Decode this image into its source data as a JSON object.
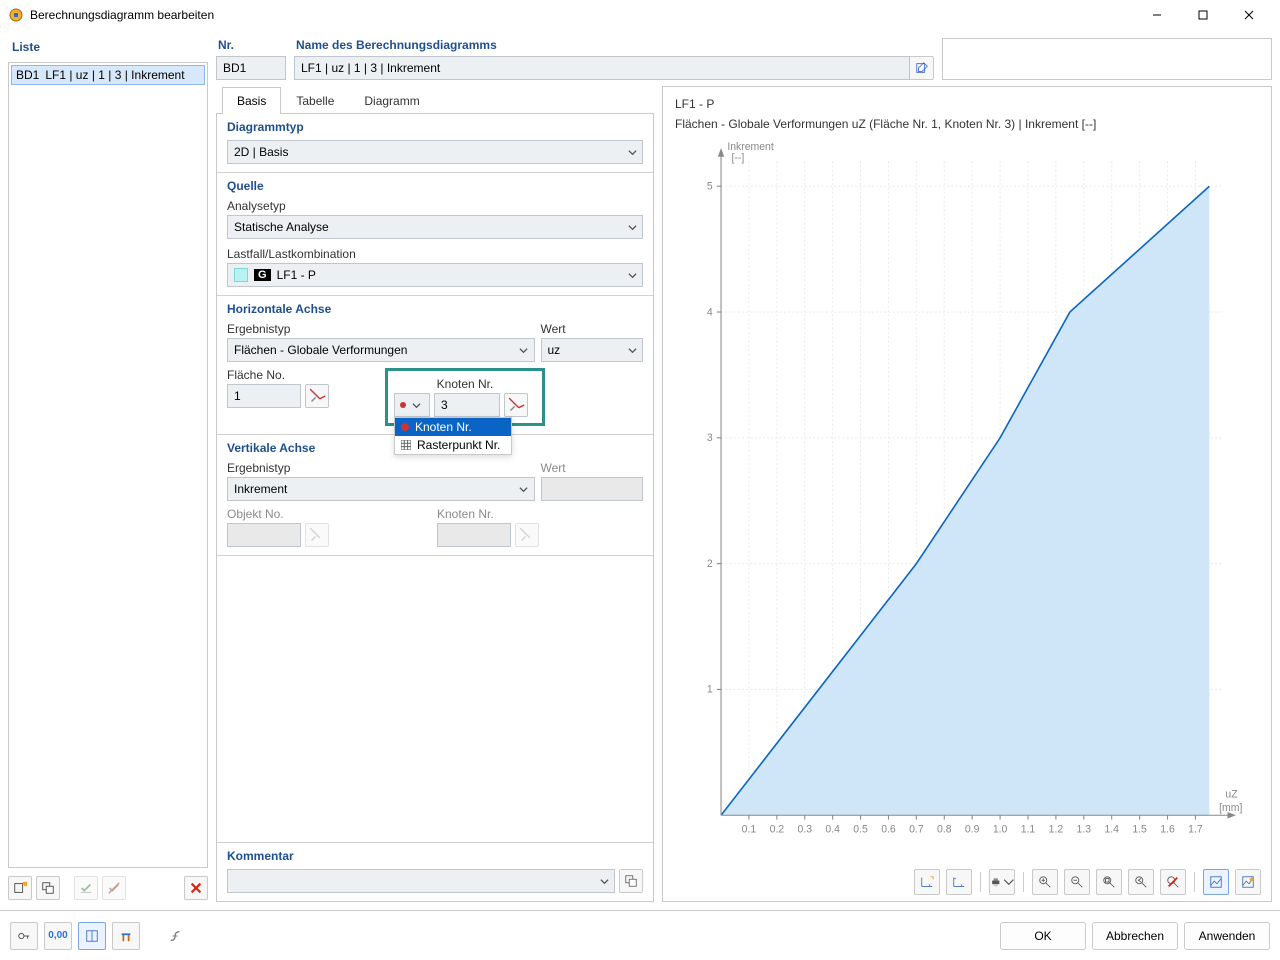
{
  "window": {
    "title": "Berechnungsdiagramm bearbeiten"
  },
  "left": {
    "panel_title": "Liste",
    "item_id": "BD1",
    "item_label": "LF1 | uz | 1 | 3 | Inkrement"
  },
  "header": {
    "nr_label": "Nr.",
    "nr_value": "BD1",
    "name_label": "Name des Berechnungsdiagramms",
    "name_value": "LF1 | uᴢ | 1 | 3 | Inkrement"
  },
  "tabs": {
    "basis": "Basis",
    "tabelle": "Tabelle",
    "diagramm": "Diagramm"
  },
  "form": {
    "diagrammtyp_title": "Diagrammtyp",
    "diagrammtyp_value": "2D | Basis",
    "quelle_title": "Quelle",
    "analysetyp_label": "Analysetyp",
    "analysetyp_value": "Statische Analyse",
    "lastfall_label": "Lastfall/Lastkombination",
    "lastfall_badge": "G",
    "lastfall_value": "LF1 - P",
    "hachse_title": "Horizontale Achse",
    "ergebnistyp_label": "Ergebnistyp",
    "ergebnistyp_value": "Flächen - Globale Verformungen",
    "wert_label": "Wert",
    "wert_value": "uᴢ",
    "flaeche_label": "Fläche No.",
    "flaeche_value": "1",
    "knoten_label": "Knoten Nr.",
    "knoten_value": "3",
    "dropdown_opt1": "Knoten Nr.",
    "dropdown_opt2": "Rasterpunkt Nr.",
    "vachse_title": "Vertikale Achse",
    "v_ergebnistyp_label": "Ergebnistyp",
    "v_ergebnistyp_value": "Inkrement",
    "v_wert_label": "Wert",
    "objekt_label": "Objekt No.",
    "v_knoten_label": "Knoten Nr.",
    "kommentar_title": "Kommentar"
  },
  "chart": {
    "title1": "LF1 - P",
    "title2": "Flächen - Globale Verformungen uZ (Fläche Nr. 1, Knoten Nr. 3) | Inkrement [--]",
    "y_axis_label": "Inkrement",
    "y_axis_unit": "[--]",
    "x_axis_label": "uZ",
    "x_axis_unit": "[mm]"
  },
  "chart_data": {
    "type": "area",
    "x": [
      0,
      0.35,
      0.7,
      1.0,
      1.25,
      1.75
    ],
    "y": [
      0,
      1,
      2,
      3,
      4,
      5
    ],
    "xlim": [
      0,
      1.8
    ],
    "ylim": [
      0,
      5.2
    ],
    "xticks": [
      0.1,
      0.2,
      0.3,
      0.4,
      0.5,
      0.6,
      0.7,
      0.8,
      0.9,
      1.0,
      1.1,
      1.2,
      1.3,
      1.4,
      1.5,
      1.6,
      1.7
    ],
    "yticks": [
      1,
      2,
      3,
      4,
      5
    ]
  },
  "buttons": {
    "ok": "OK",
    "abbrechen": "Abbrechen",
    "anwenden": "Anwenden"
  }
}
